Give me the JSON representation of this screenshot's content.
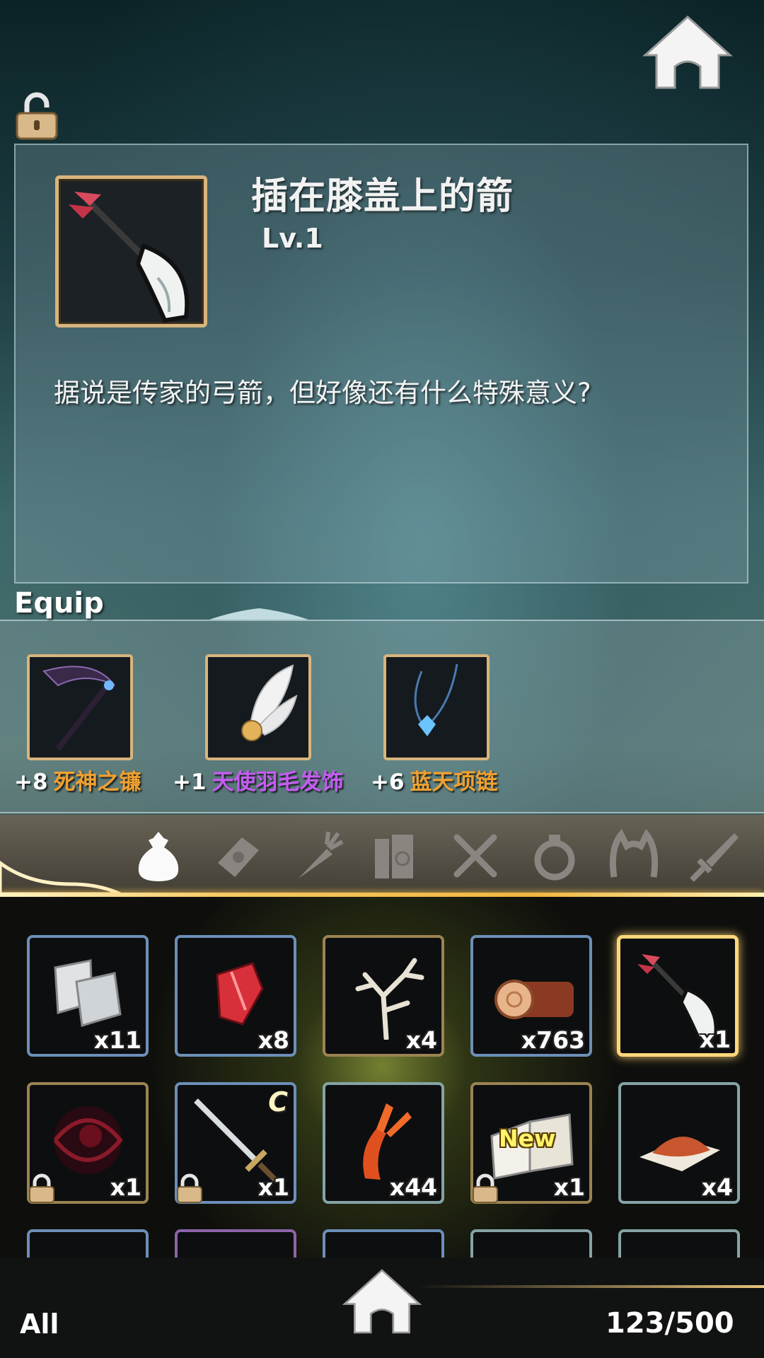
{
  "top": {
    "home_icon": "home-icon",
    "lock_icon": "unlock-icon"
  },
  "detail": {
    "item_name": "插在膝盖上的箭",
    "item_level": "Lv.1",
    "item_description": "据说是传家的弓箭，但好像还有什么特殊意义?"
  },
  "equip": {
    "title": "Equip",
    "items": [
      {
        "plus": "+8",
        "name": "死神之镰",
        "color": "#f0a030",
        "icon": "scythe-icon"
      },
      {
        "plus": "+1",
        "name": "天使羽毛发饰",
        "color": "#c45cf0",
        "icon": "feather-hairpin-icon"
      },
      {
        "plus": "+6",
        "name": "蓝天项链",
        "color": "#f0a030",
        "icon": "blue-necklace-icon"
      }
    ]
  },
  "categories": [
    "bag-icon",
    "letter-icon",
    "carrot-icon",
    "books-icon",
    "utensils-icon",
    "ring-icon",
    "headband-icon",
    "sword-icon"
  ],
  "inventory": {
    "rows": [
      [
        {
          "icon": "metal-plates-icon",
          "count": "x11"
        },
        {
          "icon": "red-crystal-icon",
          "count": "x8"
        },
        {
          "icon": "antler-icon",
          "count": "x4"
        },
        {
          "icon": "wood-log-icon",
          "count": "x763"
        },
        {
          "icon": "arrow-icon",
          "count": "x1"
        }
      ],
      [
        {
          "icon": "dark-orb-icon",
          "count": "x1"
        },
        {
          "icon": "longsword-icon",
          "count": "x1",
          "grade": "C"
        },
        {
          "icon": "lobster-icon",
          "count": "x44"
        },
        {
          "icon": "open-book-icon",
          "count": "x1",
          "tag": "New"
        },
        {
          "icon": "powder-icon",
          "count": "x4"
        }
      ]
    ]
  },
  "footer": {
    "filter": "All",
    "capacity": "123/500"
  }
}
